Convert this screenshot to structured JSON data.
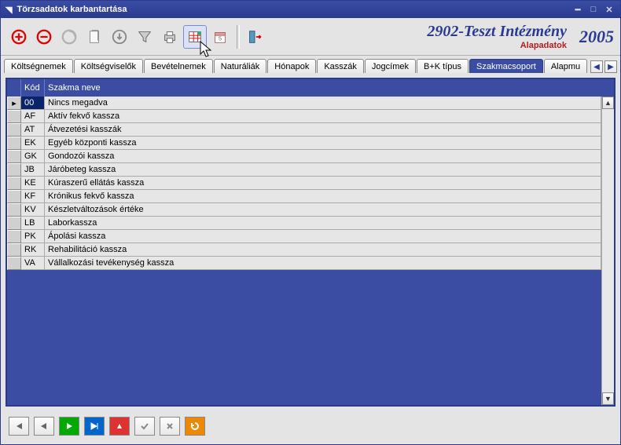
{
  "window": {
    "title": "Törzsadatok karbantartása"
  },
  "header": {
    "institution": "2902-Teszt Intézmény",
    "subtitle": "Alapadatok",
    "year": "2005"
  },
  "tabs": [
    "Költségnemek",
    "Költségviselők",
    "Bevételnemek",
    "Naturáliák",
    "Hónapok",
    "Kasszák",
    "Jogcímek",
    "B+K típus",
    "Szakmacsoport",
    "Alapmu"
  ],
  "active_tab_index": 8,
  "grid": {
    "headers": {
      "code": "Kód",
      "name": "Szakma neve"
    },
    "rows": [
      {
        "code": "00",
        "name": "Nincs megadva"
      },
      {
        "code": "AF",
        "name": "Aktív fekvő kassza"
      },
      {
        "code": "AT",
        "name": "Átvezetési kasszák"
      },
      {
        "code": "EK",
        "name": "Egyéb központi kassza"
      },
      {
        "code": "GK",
        "name": "Gondozói kassza"
      },
      {
        "code": "JB",
        "name": "Járóbeteg kassza"
      },
      {
        "code": "KE",
        "name": "Kúraszerű ellátás kassza"
      },
      {
        "code": "KF",
        "name": "Krónikus fekvő kassza"
      },
      {
        "code": "KV",
        "name": "Készletváltozások értéke"
      },
      {
        "code": "LB",
        "name": "Laborkassza"
      },
      {
        "code": "PK",
        "name": "Ápolási kassza"
      },
      {
        "code": "RK",
        "name": "Rehabilitáció kassza"
      },
      {
        "code": "VA",
        "name": "Vállalkozási tevékenység kassza"
      }
    ]
  },
  "icons": {
    "add": "add-icon",
    "delete": "delete-icon",
    "refresh": "refresh-icon",
    "copy": "copy-icon",
    "down": "down-arrow-icon",
    "filter": "filter-icon",
    "print": "print-icon",
    "spreadsheet": "spreadsheet-icon",
    "calendar": "calendar-icon",
    "exit": "exit-icon"
  }
}
